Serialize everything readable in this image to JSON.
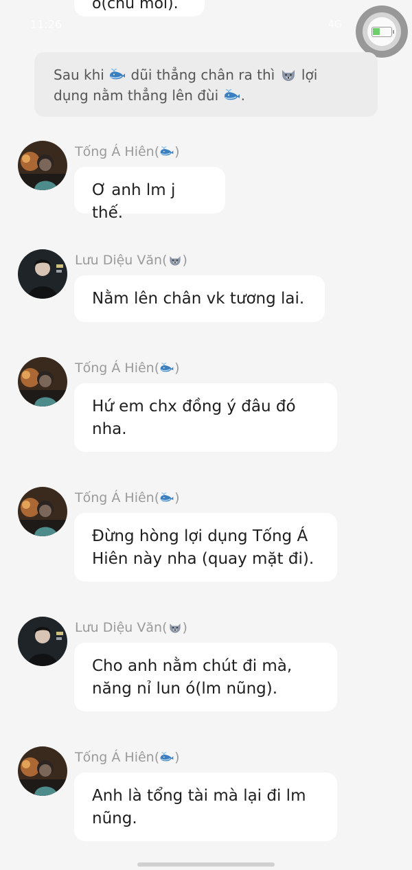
{
  "status_bar": {
    "time": "11:26",
    "right": "4G"
  },
  "top_partial_message": "ó(chù môi).",
  "narration": {
    "part1": "Sau khi",
    "part2": "dũi thẳng chân ra thì",
    "part3": "lợi",
    "part4": "dụng nằm thẳng lên đùi",
    "part5": "."
  },
  "messages": [
    {
      "sender": "Tống Á Hiên",
      "sender_emoji": "whale",
      "text": "Ơ anh lm j thế."
    },
    {
      "sender": "Lưu Diệu Văn",
      "sender_emoji": "wolf",
      "text": "Nằm lên chân vk tương lai."
    },
    {
      "sender": "Tống Á Hiên",
      "sender_emoji": "whale",
      "text": "Hứ em chx đồng ý đâu đó nha."
    },
    {
      "sender": "Tống Á Hiên",
      "sender_emoji": "whale",
      "text": "Đừng hòng lợi dụng Tống Á Hiên này nha (quay mặt đi)."
    },
    {
      "sender": "Lưu Diệu Văn",
      "sender_emoji": "wolf",
      "text": "Cho anh nằm chút đi mà, năng nỉ lun ó(lm nũng)."
    },
    {
      "sender": "Tống Á Hiên",
      "sender_emoji": "whale",
      "text": "Anh là tổng tài mà lại đi lm nũng."
    }
  ],
  "colors": {
    "background": "#f5f5f5",
    "bubble": "#ffffff",
    "narration_bg": "#ececec",
    "sender_name": "#9a9a9a",
    "whale": "#3b7fc0",
    "wolf": "#8a96a6"
  }
}
